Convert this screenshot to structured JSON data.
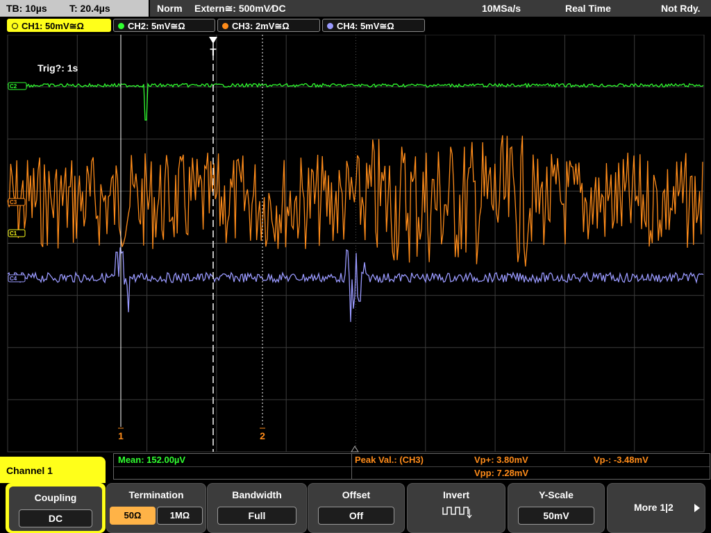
{
  "topbar": {
    "timebase": "TB: 10µs",
    "trigger_time": "T: 20.4µs",
    "mode": "Norm",
    "trigger_source": "Extern≅: 500mV∕DC",
    "sample_rate": "10MSa/s",
    "acq_mode": "Real Time",
    "status": "Not Rdy."
  },
  "channel_tabs": [
    {
      "label": "CH1: 50mV≅Ω",
      "color": "#ffff1a"
    },
    {
      "label": "CH2: 5mV≅Ω",
      "color": "#30ff30"
    },
    {
      "label": "CH3: 2mV≅Ω",
      "color": "#ff8c1a"
    },
    {
      "label": "CH4: 5mV≅Ω",
      "color": "#9a9aff"
    }
  ],
  "display": {
    "trig_text": "Trig?: 1s",
    "trigger_marker": "T",
    "cursor1_label": "1",
    "cursor2_label": "2",
    "ch3_marker": "C3",
    "ch1_marker": "C1",
    "ch2_marker": "C2",
    "ch4_marker": "C4",
    "colors": {
      "ch1": "#ffff1a",
      "ch2": "#30ff30",
      "ch3": "#ff8c1a",
      "ch4": "#9a9aff",
      "grid": "#3c3c3c"
    }
  },
  "measurements": {
    "mean": "Mean: 152.00µV",
    "peak_title": "Peak Val.:  (CH3)",
    "vp_plus": "Vp+: 3.80mV",
    "vp_minus": "Vp-: -3.48mV",
    "vpp": "Vpp: 7.28mV"
  },
  "menu": {
    "channel_name": "Channel 1",
    "coupling": {
      "title": "Coupling",
      "value": "DC"
    },
    "termination": {
      "title": "Termination",
      "opt1": "50Ω",
      "opt2": "1MΩ",
      "selected": "50Ω"
    },
    "bandwidth": {
      "title": "Bandwidth",
      "value": "Full"
    },
    "offset": {
      "title": "Offset",
      "value": "Off"
    },
    "invert": {
      "title": "Invert",
      "icon": "invert-waveform-icon"
    },
    "yscale": {
      "title": "Y-Scale",
      "value": "50mV"
    },
    "more": {
      "label": "More 1|2",
      "icon": "arrow-right-icon"
    }
  }
}
